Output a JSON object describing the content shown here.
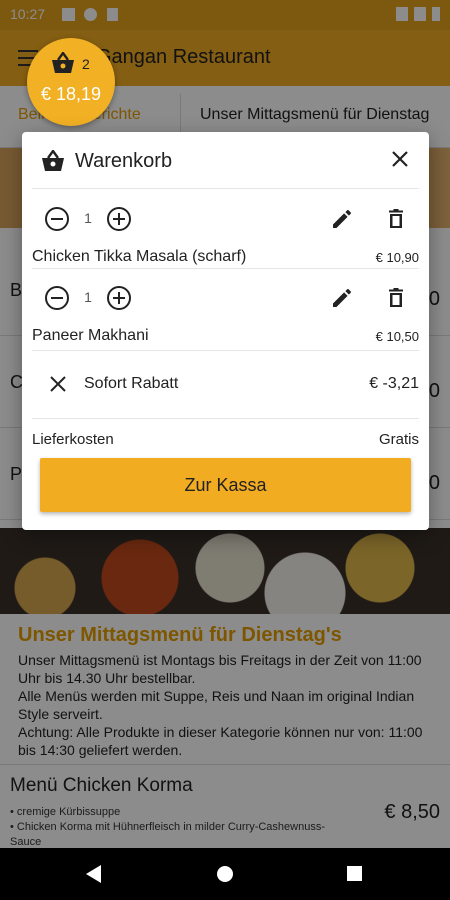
{
  "status_bar": {
    "time": "10:27"
  },
  "app_bar": {
    "title": "Gangan Restaurant"
  },
  "tabs": [
    {
      "label": "Beliebte Gerichte"
    },
    {
      "label": "Unser Mittagsmenü für Dienstag"
    }
  ],
  "background": {
    "row_letters": [
      "B",
      "C",
      "P"
    ],
    "row_price_fragment": "0",
    "lunch_title": "Unser Mittagsmenü für Dienstag's",
    "lunch_text": "Unser Mittagsmenü ist Montags bis Freitags in der Zeit von 11:00 Uhr bis 14.30 Uhr bestellbar.\nAlle Menüs werden mit Suppe, Reis und Naan im original Indian Style serveirt.\nAchtung: Alle Produkte in dieser Kategorie können nur von: 11:00 bis 14:30 geliefert werden.",
    "menu_item": {
      "name": "Menü Chicken Korma",
      "desc": "• cremige Kürbissuppe\n• Chicken Korma mit Hühnerfleisch in milder Curry-Cashewnuss-Sauce",
      "price": "€ 8,50"
    }
  },
  "cart_badge": {
    "count": "2",
    "total": "€ 18,19"
  },
  "cart_dialog": {
    "title": "Warenkorb",
    "items": [
      {
        "qty": "1",
        "name": "Chicken Tikka Masala (scharf)",
        "price": "€ 10,90"
      },
      {
        "qty": "1",
        "name": "Paneer Makhani",
        "price": "€ 10,50"
      }
    ],
    "discount": {
      "label": "Sofort Rabatt",
      "value": "€ -3,21"
    },
    "delivery": {
      "label": "Lieferkosten",
      "value": "Gratis"
    },
    "checkout_label": "Zur Kassa"
  },
  "colors": {
    "accent": "#f2ac22",
    "accent_text": "#e59d00"
  },
  "icons": [
    "menu-icon",
    "basket-icon",
    "close-icon",
    "minus-circle-icon",
    "plus-circle-icon",
    "edit-icon",
    "delete-icon",
    "x-icon"
  ]
}
